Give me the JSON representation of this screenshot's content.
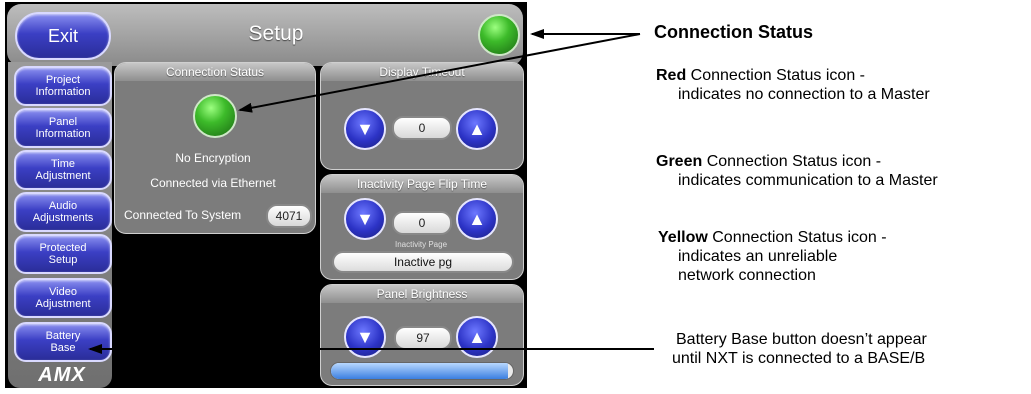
{
  "panel": {
    "title": "Setup",
    "exit_label": "Exit",
    "sidebar": [
      "Project\nInformation",
      "Panel\nInformation",
      "Time\nAdjustment",
      "Audio\nAdjustments",
      "Protected\nSetup",
      "Video\nAdjustment",
      "Battery\nBase"
    ],
    "logo": "AMX",
    "connection_status": {
      "title": "Connection Status",
      "encryption": "No Encryption",
      "connected_via": "Connected via Ethernet",
      "system_label": "Connected To System",
      "system_number": "4071"
    },
    "display_timeout": {
      "title": "Display Timeout",
      "value": "0"
    },
    "inactivity": {
      "title": "Inactivity Page Flip Time",
      "value": "0",
      "page_label": "Inactivity Page",
      "page_value": "Inactive pg"
    },
    "brightness": {
      "title": "Panel Brightness",
      "value": "97",
      "level_percent": 97
    },
    "colors": {
      "led_green": "#3dbb2a",
      "button_blue": "#2c33c6"
    }
  },
  "annotations": {
    "heading": "Connection Status",
    "red": {
      "bold": "Red",
      "rest": " Connection Status icon -",
      "line2": "indicates no connection to a Master"
    },
    "green": {
      "bold": "Green",
      "rest": " Connection Status icon -",
      "line2": "indicates communication to a Master"
    },
    "yellow": {
      "bold": "Yellow",
      "rest": " Connection Status icon -",
      "line2": "indicates an unreliable",
      "line3": "network connection"
    },
    "battery": {
      "line1": "Battery Base button doesn’t appear",
      "line2": "until NXT is connected to a BASE/B"
    }
  }
}
